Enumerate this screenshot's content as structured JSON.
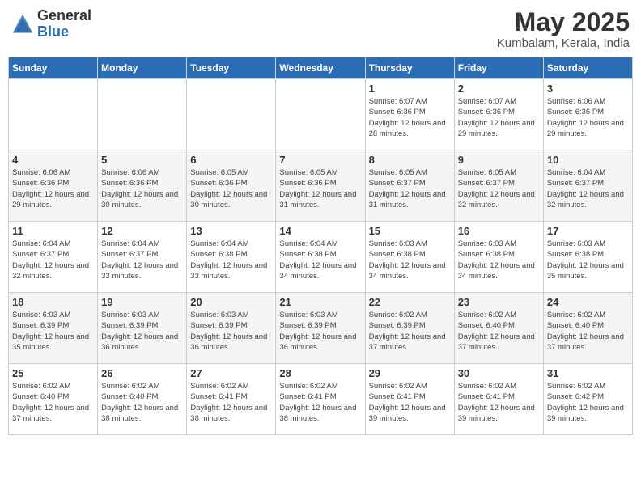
{
  "header": {
    "logo_general": "General",
    "logo_blue": "Blue",
    "month_year": "May 2025",
    "location": "Kumbalam, Kerala, India"
  },
  "days_of_week": [
    "Sunday",
    "Monday",
    "Tuesday",
    "Wednesday",
    "Thursday",
    "Friday",
    "Saturday"
  ],
  "weeks": [
    [
      {
        "day": "",
        "sunrise": "",
        "sunset": "",
        "daylight": ""
      },
      {
        "day": "",
        "sunrise": "",
        "sunset": "",
        "daylight": ""
      },
      {
        "day": "",
        "sunrise": "",
        "sunset": "",
        "daylight": ""
      },
      {
        "day": "",
        "sunrise": "",
        "sunset": "",
        "daylight": ""
      },
      {
        "day": "1",
        "sunrise": "Sunrise: 6:07 AM",
        "sunset": "Sunset: 6:36 PM",
        "daylight": "Daylight: 12 hours and 28 minutes."
      },
      {
        "day": "2",
        "sunrise": "Sunrise: 6:07 AM",
        "sunset": "Sunset: 6:36 PM",
        "daylight": "Daylight: 12 hours and 29 minutes."
      },
      {
        "day": "3",
        "sunrise": "Sunrise: 6:06 AM",
        "sunset": "Sunset: 6:36 PM",
        "daylight": "Daylight: 12 hours and 29 minutes."
      }
    ],
    [
      {
        "day": "4",
        "sunrise": "Sunrise: 6:06 AM",
        "sunset": "Sunset: 6:36 PM",
        "daylight": "Daylight: 12 hours and 29 minutes."
      },
      {
        "day": "5",
        "sunrise": "Sunrise: 6:06 AM",
        "sunset": "Sunset: 6:36 PM",
        "daylight": "Daylight: 12 hours and 30 minutes."
      },
      {
        "day": "6",
        "sunrise": "Sunrise: 6:05 AM",
        "sunset": "Sunset: 6:36 PM",
        "daylight": "Daylight: 12 hours and 30 minutes."
      },
      {
        "day": "7",
        "sunrise": "Sunrise: 6:05 AM",
        "sunset": "Sunset: 6:36 PM",
        "daylight": "Daylight: 12 hours and 31 minutes."
      },
      {
        "day": "8",
        "sunrise": "Sunrise: 6:05 AM",
        "sunset": "Sunset: 6:37 PM",
        "daylight": "Daylight: 12 hours and 31 minutes."
      },
      {
        "day": "9",
        "sunrise": "Sunrise: 6:05 AM",
        "sunset": "Sunset: 6:37 PM",
        "daylight": "Daylight: 12 hours and 32 minutes."
      },
      {
        "day": "10",
        "sunrise": "Sunrise: 6:04 AM",
        "sunset": "Sunset: 6:37 PM",
        "daylight": "Daylight: 12 hours and 32 minutes."
      }
    ],
    [
      {
        "day": "11",
        "sunrise": "Sunrise: 6:04 AM",
        "sunset": "Sunset: 6:37 PM",
        "daylight": "Daylight: 12 hours and 32 minutes."
      },
      {
        "day": "12",
        "sunrise": "Sunrise: 6:04 AM",
        "sunset": "Sunset: 6:37 PM",
        "daylight": "Daylight: 12 hours and 33 minutes."
      },
      {
        "day": "13",
        "sunrise": "Sunrise: 6:04 AM",
        "sunset": "Sunset: 6:38 PM",
        "daylight": "Daylight: 12 hours and 33 minutes."
      },
      {
        "day": "14",
        "sunrise": "Sunrise: 6:04 AM",
        "sunset": "Sunset: 6:38 PM",
        "daylight": "Daylight: 12 hours and 34 minutes."
      },
      {
        "day": "15",
        "sunrise": "Sunrise: 6:03 AM",
        "sunset": "Sunset: 6:38 PM",
        "daylight": "Daylight: 12 hours and 34 minutes."
      },
      {
        "day": "16",
        "sunrise": "Sunrise: 6:03 AM",
        "sunset": "Sunset: 6:38 PM",
        "daylight": "Daylight: 12 hours and 34 minutes."
      },
      {
        "day": "17",
        "sunrise": "Sunrise: 6:03 AM",
        "sunset": "Sunset: 6:38 PM",
        "daylight": "Daylight: 12 hours and 35 minutes."
      }
    ],
    [
      {
        "day": "18",
        "sunrise": "Sunrise: 6:03 AM",
        "sunset": "Sunset: 6:39 PM",
        "daylight": "Daylight: 12 hours and 35 minutes."
      },
      {
        "day": "19",
        "sunrise": "Sunrise: 6:03 AM",
        "sunset": "Sunset: 6:39 PM",
        "daylight": "Daylight: 12 hours and 36 minutes."
      },
      {
        "day": "20",
        "sunrise": "Sunrise: 6:03 AM",
        "sunset": "Sunset: 6:39 PM",
        "daylight": "Daylight: 12 hours and 36 minutes."
      },
      {
        "day": "21",
        "sunrise": "Sunrise: 6:03 AM",
        "sunset": "Sunset: 6:39 PM",
        "daylight": "Daylight: 12 hours and 36 minutes."
      },
      {
        "day": "22",
        "sunrise": "Sunrise: 6:02 AM",
        "sunset": "Sunset: 6:39 PM",
        "daylight": "Daylight: 12 hours and 37 minutes."
      },
      {
        "day": "23",
        "sunrise": "Sunrise: 6:02 AM",
        "sunset": "Sunset: 6:40 PM",
        "daylight": "Daylight: 12 hours and 37 minutes."
      },
      {
        "day": "24",
        "sunrise": "Sunrise: 6:02 AM",
        "sunset": "Sunset: 6:40 PM",
        "daylight": "Daylight: 12 hours and 37 minutes."
      }
    ],
    [
      {
        "day": "25",
        "sunrise": "Sunrise: 6:02 AM",
        "sunset": "Sunset: 6:40 PM",
        "daylight": "Daylight: 12 hours and 37 minutes."
      },
      {
        "day": "26",
        "sunrise": "Sunrise: 6:02 AM",
        "sunset": "Sunset: 6:40 PM",
        "daylight": "Daylight: 12 hours and 38 minutes."
      },
      {
        "day": "27",
        "sunrise": "Sunrise: 6:02 AM",
        "sunset": "Sunset: 6:41 PM",
        "daylight": "Daylight: 12 hours and 38 minutes."
      },
      {
        "day": "28",
        "sunrise": "Sunrise: 6:02 AM",
        "sunset": "Sunset: 6:41 PM",
        "daylight": "Daylight: 12 hours and 38 minutes."
      },
      {
        "day": "29",
        "sunrise": "Sunrise: 6:02 AM",
        "sunset": "Sunset: 6:41 PM",
        "daylight": "Daylight: 12 hours and 39 minutes."
      },
      {
        "day": "30",
        "sunrise": "Sunrise: 6:02 AM",
        "sunset": "Sunset: 6:41 PM",
        "daylight": "Daylight: 12 hours and 39 minutes."
      },
      {
        "day": "31",
        "sunrise": "Sunrise: 6:02 AM",
        "sunset": "Sunset: 6:42 PM",
        "daylight": "Daylight: 12 hours and 39 minutes."
      }
    ]
  ]
}
